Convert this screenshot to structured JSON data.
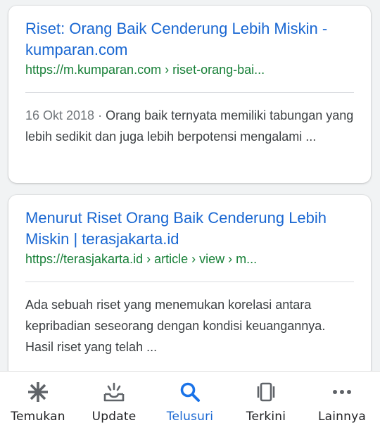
{
  "results": [
    {
      "title": "Riset: Orang Baik Cenderung Lebih Miskin - kumparan.com",
      "url": "https://m.kumparan.com › riset-orang-bai...",
      "date": "16 Okt 2018",
      "date_sep": " · ",
      "snippet": "Orang baik ternyata memiliki tabungan yang lebih sedikit dan juga lebih berpotensi mengalami ..."
    },
    {
      "title": "Menurut Riset Orang Baik Cenderung Lebih Miskin | terasjakarta.id",
      "url": "https://terasjakarta.id › article › view › m...",
      "snippet": "Ada sebuah riset yang menemukan korelasi antara kepribadian seseorang dengan kondisi keuangannya. Hasil riset yang telah ..."
    }
  ],
  "bottom_nav": {
    "items": [
      {
        "label": "Temukan",
        "icon": "asterisk-icon"
      },
      {
        "label": "Update",
        "icon": "inbox-icon"
      },
      {
        "label": "Telusuri",
        "icon": "search-icon",
        "active": true
      },
      {
        "label": "Terkini",
        "icon": "cards-icon"
      },
      {
        "label": "Lainnya",
        "icon": "more-dots-icon"
      }
    ]
  },
  "colors": {
    "link": "#1967d2",
    "url": "#188038",
    "text": "#3c4043",
    "muted": "#70757a",
    "nav_icon": "#5f6368",
    "active": "#1a73e8"
  }
}
